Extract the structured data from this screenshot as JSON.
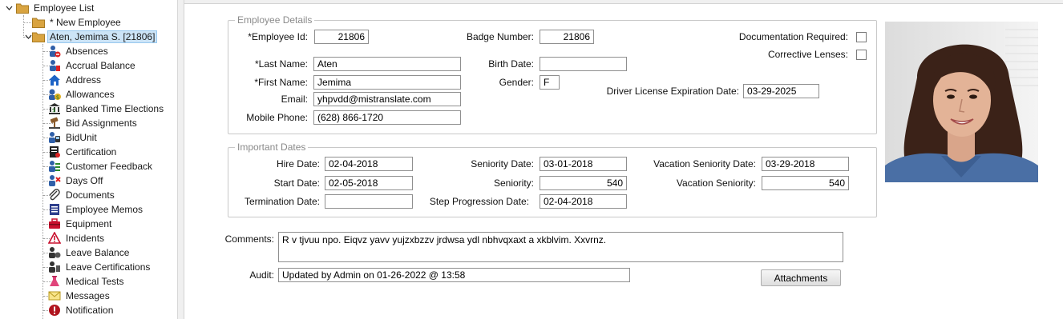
{
  "tree": {
    "root_label": "Employee List",
    "new_label": "* New Employee",
    "selected_label": "Aten, Jemima S. [21806]",
    "items": [
      {
        "label": "Absences",
        "icon": "absences-icon"
      },
      {
        "label": "Accrual Balance",
        "icon": "accrual-icon"
      },
      {
        "label": "Address",
        "icon": "house-icon"
      },
      {
        "label": "Allowances",
        "icon": "money-icon"
      },
      {
        "label": "Banked Time Elections",
        "icon": "bank-icon"
      },
      {
        "label": "Bid Assignments",
        "icon": "gavel-icon"
      },
      {
        "label": "BidUnit",
        "icon": "bus-icon"
      },
      {
        "label": "Certification",
        "icon": "certificate-icon"
      },
      {
        "label": "Customer Feedback",
        "icon": "feedback-icon"
      },
      {
        "label": "Days Off",
        "icon": "days-off-icon"
      },
      {
        "label": "Documents",
        "icon": "paperclip-icon"
      },
      {
        "label": "Employee Memos",
        "icon": "memo-icon"
      },
      {
        "label": "Equipment",
        "icon": "toolbox-icon"
      },
      {
        "label": "Incidents",
        "icon": "warning-icon"
      },
      {
        "label": "Leave Balance",
        "icon": "leave-balance-icon"
      },
      {
        "label": "Leave Certifications",
        "icon": "leave-cert-icon"
      },
      {
        "label": "Medical Tests",
        "icon": "flask-icon"
      },
      {
        "label": "Messages",
        "icon": "envelope-icon"
      },
      {
        "label": "Notification",
        "icon": "alert-icon"
      }
    ]
  },
  "employee_details": {
    "legend": "Employee Details",
    "employee_id_label": "*Employee Id:",
    "employee_id": "21806",
    "badge_number_label": "Badge Number:",
    "badge_number": "21806",
    "documentation_required_label": "Documentation Required:",
    "documentation_required": false,
    "corrective_lenses_label": "Corrective Lenses:",
    "corrective_lenses": false,
    "last_name_label": "*Last Name:",
    "last_name": "Aten",
    "birth_date_label": "Birth Date:",
    "birth_date": "",
    "first_name_label": "*First Name:",
    "first_name": "Jemima",
    "gender_label": "Gender:",
    "gender": "F",
    "email_label": "Email:",
    "email": "yhpvdd@mistranslate.com",
    "driver_license_label": "Driver License Expiration Date:",
    "driver_license_expiration": "03-29-2025",
    "mobile_phone_label": "Mobile Phone:",
    "mobile_phone": "(628) 866-1720"
  },
  "important_dates": {
    "legend": "Important Dates",
    "hire_date_label": "Hire Date:",
    "hire_date": "02-04-2018",
    "seniority_date_label": "Seniority Date:",
    "seniority_date": "03-01-2018",
    "vacation_seniority_date_label": "Vacation Seniority Date:",
    "vacation_seniority_date": "03-29-2018",
    "start_date_label": "Start Date:",
    "start_date": "02-05-2018",
    "seniority_label": "Seniority:",
    "seniority": "540",
    "vacation_seniority_label": "Vacation Seniority:",
    "vacation_seniority": "540",
    "termination_date_label": "Termination Date:",
    "termination_date": "",
    "step_progression_date_label": "Step Progression Date:",
    "step_progression_date": "02-04-2018"
  },
  "comments_label": "Comments:",
  "comments": "R v tjvuu npo. Eiqvz yavv yujzxbzzv jrdwsa ydl nbhvqxaxt a xkblvim. Xxvrnz.",
  "audit_label": "Audit:",
  "audit": "Updated by Admin on 01-26-2022 @ 13:58",
  "attachments_button": "Attachments",
  "colors": {
    "selection": "#cce4f7",
    "folder": "#d9a441",
    "legend_text": "#8a8a8a"
  }
}
